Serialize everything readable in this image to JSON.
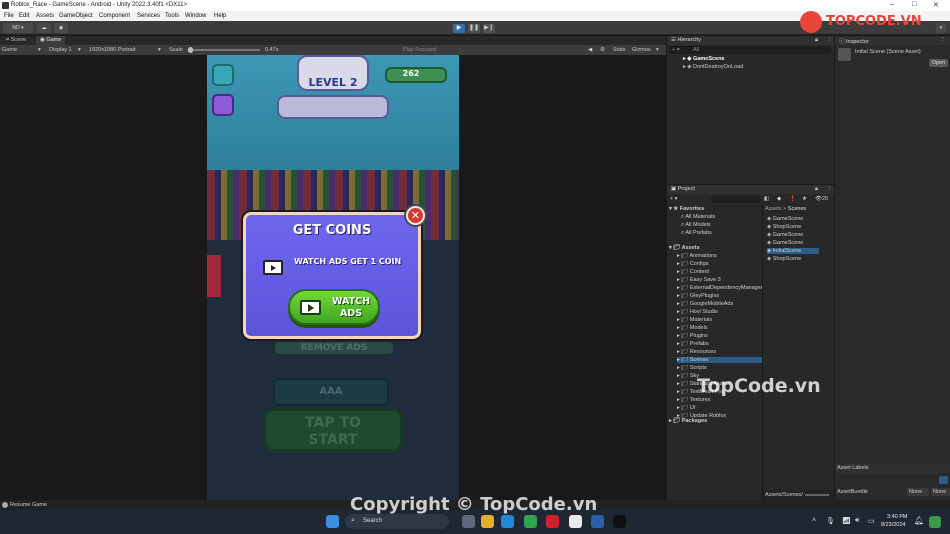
{
  "window": {
    "title": "Roblox_Race - GameScene - Android - Unity 2022.3.40f1 <DX11>"
  },
  "menu": [
    "File",
    "Edit",
    "Assets",
    "GameObject",
    "Component",
    "Services",
    "Tools",
    "Window",
    "Help"
  ],
  "toolbar": {
    "account": "ND"
  },
  "scene_tabs": {
    "scene": "Scene",
    "game": "Game"
  },
  "gamebar": {
    "mode": "Game",
    "display": "Display 1",
    "resolution": "1920x1080 Portrait",
    "scale_label": "Scale",
    "scale_value": "0.47x",
    "play_focused": "Play Focused",
    "stats": "Stats",
    "gizmos": "Gizmos"
  },
  "game": {
    "level": "LEVEL 2",
    "coins": "262",
    "popup_title": "GET COINS",
    "popup_desc": "WATCH ADS GET 1 COIN",
    "watch_button": "WATCH ADS",
    "remove_ads": "REMOVE ADS",
    "aaa": "AAA",
    "tap_to_start": "TAP TO START"
  },
  "hierarchy": {
    "title": "Hierarchy",
    "search": "All",
    "items": [
      "GameScene",
      "DontDestroyOnLoad"
    ]
  },
  "inspector": {
    "title": "Inspector",
    "object": "Initial Scene (Scene Asset)",
    "open": "Open",
    "labels": "Asset Labels",
    "bundle": "AssetBundle",
    "bundle_value": "None",
    "variant_value": "None"
  },
  "project": {
    "title": "Project",
    "count": "20",
    "favorites_label": "Favorites",
    "favorites": [
      "All Materials",
      "All Models",
      "All Prefabs"
    ],
    "assets_label": "Assets",
    "folders": [
      "Animations",
      "Configs",
      "Content",
      "Easy Save 3",
      "ExternalDependencyManager",
      "GleyPlugins",
      "GoogleMobileAds",
      "Hovl Studio",
      "Materials",
      "Models",
      "Plugins",
      "Prefabs",
      "Resources",
      "Scenes",
      "Scripts",
      "Sky",
      "Standard Assets",
      "TextMesh Pro",
      "Textures",
      "UI",
      "Update Roblox"
    ],
    "packages_label": "Packages",
    "breadcrumb_root": "Assets",
    "breadcrumb_leaf": "Scenes",
    "scene_files": [
      "GameScene",
      "ShopScene",
      "GameScene",
      "GameScene",
      "InitialScene",
      "ShopScene"
    ],
    "footer": "Assets/Scenes/InitialScene.unity"
  },
  "status": {
    "text": "Resume Game"
  },
  "taskbar": {
    "search": "Search",
    "time": "3:40 PM",
    "date": "8/23/2024"
  },
  "watermark": {
    "logo": "TOPCODE.VN",
    "center": "TopCode.vn",
    "bottom": "Copyright © TopCode.vn"
  },
  "colors": {
    "accent": "#4f7fb3",
    "popup": "#6a62ec",
    "button_green": "#5cc52e",
    "close_red": "#d63a2f"
  }
}
